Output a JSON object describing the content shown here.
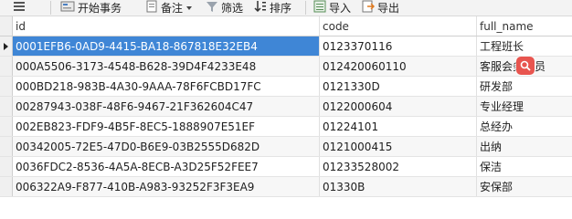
{
  "toolbar": {
    "menu_icon": "hamburger-icon",
    "begin_transaction": "开始事务",
    "note": "备注",
    "filter": "筛选",
    "sort": "排序",
    "import": "导入",
    "export": "导出"
  },
  "columns": [
    "id",
    "code",
    "full_name"
  ],
  "rows": [
    {
      "id": "0001EFB6-0AD9-4415-BA18-867818E32EB4",
      "code": "0123370116",
      "full_name": "工程班长"
    },
    {
      "id": "000A5506-3173-4548-B628-39D4F4233E48",
      "code": "012420060110",
      "full_name": "客服会务专员"
    },
    {
      "id": "000BD218-983B-4A30-9AAA-78F6FCBD17FC",
      "code": "0121330D",
      "full_name": "研发部"
    },
    {
      "id": "00287943-038F-48F6-9467-21F362604C47",
      "code": "0122000604",
      "full_name": "专业经理"
    },
    {
      "id": "002EB823-FDF9-4B5F-8EC5-1888907E51EF",
      "code": "01224101",
      "full_name": "总经办"
    },
    {
      "id": "00342005-72E5-47D0-B6E9-03B2555D682D",
      "code": "0121000415",
      "full_name": "出纳"
    },
    {
      "id": "0036FDC2-8536-4A5A-8ECB-A3D25F52FEE7",
      "code": "01233528002",
      "full_name": "保洁"
    },
    {
      "id": "006322A9-F877-410B-A983-93252F3F3EA9",
      "code": "01330B",
      "full_name": "安保部"
    }
  ],
  "colors": {
    "selection": "#3f86d6",
    "overlay": "#e8554f"
  }
}
